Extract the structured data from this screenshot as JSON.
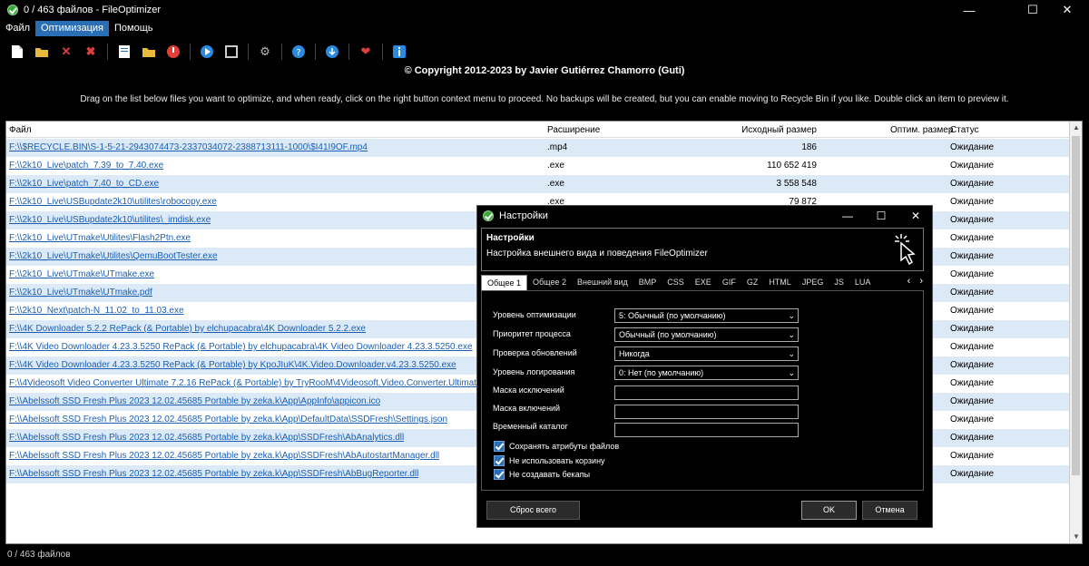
{
  "window": {
    "title": "0 / 463 файлов - FileOptimizer",
    "minimize": "—",
    "maximize": "☐",
    "close": "✕"
  },
  "menu": {
    "items": [
      {
        "label": "Файл"
      },
      {
        "label": "Оптимизация",
        "active": true
      },
      {
        "label": "Помощь"
      }
    ]
  },
  "toolbar": {
    "icons": [
      "add-files-icon",
      "add-folder-icon",
      "remove-icon",
      "clear-icon",
      "notes-icon",
      "folder-icon",
      "stop-icon",
      "play-icon",
      "pause-icon",
      "settings-icon",
      "help-icon",
      "update-icon",
      "heart-icon",
      "info-icon"
    ]
  },
  "copyright": "© Copyright 2012-2023 by Javier Gutiérrez Chamorro (Guti)",
  "instructions": "Drag on the list below files you want to optimize, and when ready, click on the right button context menu to proceed. No backups will be created, but you can enable moving to Recycle Bin if you like. Double click an item to preview it.",
  "list": {
    "headers": {
      "file": "Файл",
      "ext": "Расширение",
      "size": "Исходный размер",
      "opt": "Оптим. размер",
      "status": "Статус"
    },
    "rows": [
      {
        "file": "F:\\\\$RECYCLE.BIN\\S-1-5-21-2943074473-2337034072-2388713111-1000\\$I41I9OF.mp4",
        "ext": ".mp4",
        "size": "186",
        "status": "Ожидание"
      },
      {
        "file": "F:\\\\2k10_Live\\patch_7.39_to_7.40.exe",
        "ext": ".exe",
        "size": "110 652 419",
        "status": "Ожидание"
      },
      {
        "file": "F:\\\\2k10_Live\\patch_7.40_to_CD.exe",
        "ext": ".exe",
        "size": "3 558 548",
        "status": "Ожидание"
      },
      {
        "file": "F:\\\\2k10_Live\\USBupdate2k10\\utilites\\robocopy.exe",
        "ext": ".exe",
        "size": "79 872",
        "status": "Ожидание"
      },
      {
        "file": "F:\\\\2k10_Live\\USBupdate2k10\\utilites\\_imdisk.exe",
        "ext": "",
        "size": "",
        "status": "Ожидание"
      },
      {
        "file": "F:\\\\2k10_Live\\UTmake\\Utilites\\Flash2Ptn.exe",
        "ext": "",
        "size": "",
        "status": "Ожидание"
      },
      {
        "file": "F:\\\\2k10_Live\\UTmake\\Utilites\\QemuBootTester.exe",
        "ext": "",
        "size": "",
        "status": "Ожидание"
      },
      {
        "file": "F:\\\\2k10_Live\\UTmake\\UTmake.exe",
        "ext": "",
        "size": "",
        "status": "Ожидание"
      },
      {
        "file": "F:\\\\2k10_Live\\UTmake\\UTmake.pdf",
        "ext": "",
        "size": "",
        "status": "Ожидание"
      },
      {
        "file": "F:\\\\2k10_Next\\patch-N_11.02_to_11.03.exe",
        "ext": "",
        "size": "",
        "status": "Ожидание"
      },
      {
        "file": "F:\\\\4K Downloader 5.2.2 RePack (& Portable) by elchupacabra\\4K Downloader 5.2.2.exe",
        "ext": "",
        "size": "",
        "status": "Ожидание"
      },
      {
        "file": "F:\\\\4K Video Downloader 4.23.3.5250 RePack (& Portable) by elchupacabra\\4K Video Downloader 4.23.3.5250.exe",
        "ext": "",
        "size": "",
        "status": "Ожидание"
      },
      {
        "file": "F:\\\\4K Video Downloader 4.23.3.5250 RePack (& Portable) by KpoJIuK\\4K.Video.Downloader.v4.23.3.5250.exe",
        "ext": "",
        "size": "",
        "status": "Ожидание"
      },
      {
        "file": "F:\\\\4Videosoft Video Converter Ultimate 7.2.16 RePack (& Portable) by TryRooM\\4Videosoft.Video.Converter.Ultimate.7.2.16.exe",
        "ext": "",
        "size": "",
        "status": "Ожидание"
      },
      {
        "file": "F:\\\\Abelssoft SSD Fresh Plus 2023 12.02.45685 Portable by zeka.k\\App\\AppInfo\\appicon.ico",
        "ext": "",
        "size": "",
        "status": "Ожидание"
      },
      {
        "file": "F:\\\\Abelssoft SSD Fresh Plus 2023 12.02.45685 Portable by zeka.k\\App\\DefaultData\\SSDFresh\\Settings.json",
        "ext": "",
        "size": "",
        "status": "Ожидание"
      },
      {
        "file": "F:\\\\Abelssoft SSD Fresh Plus 2023 12.02.45685 Portable by zeka.k\\App\\SSDFresh\\AbAnalytics.dll",
        "ext": "",
        "size": "",
        "status": "Ожидание"
      },
      {
        "file": "F:\\\\Abelssoft SSD Fresh Plus 2023 12.02.45685 Portable by zeka.k\\App\\SSDFresh\\AbAutostartManager.dll",
        "ext": "",
        "size": "",
        "status": "Ожидание"
      },
      {
        "file": "F:\\\\Abelssoft SSD Fresh Plus 2023 12.02.45685 Portable by zeka.k\\App\\SSDFresh\\AbBugReporter.dll",
        "ext": "",
        "size": "",
        "status": "Ожидание"
      }
    ]
  },
  "statusbar": "0 / 463 файлов",
  "dialog": {
    "title": "Настройки",
    "header_title": "Настройки",
    "header_subtitle": "Настройка внешнего вида и поведения FileOptimizer",
    "tabs": [
      "Общее 1",
      "Общее 2",
      "Внешний вид",
      "BMP",
      "CSS",
      "EXE",
      "GIF",
      "GZ",
      "HTML",
      "JPEG",
      "JS",
      "LUA"
    ],
    "fields": {
      "opt_level_label": "Уровень оптимизации",
      "opt_level_value": "5: Обычный (по умолчанию)",
      "priority_label": "Приоритет процесса",
      "priority_value": "Обычный (по умолчанию)",
      "updates_label": "Проверка обновлений",
      "updates_value": "Никогда",
      "log_label": "Уровень логирования",
      "log_value": "0: Нет (по умолчанию)",
      "exclude_label": "Маска исключений",
      "include_label": "Маска включений",
      "temp_label": "Временный каталог"
    },
    "checkboxes": [
      {
        "label": "Сохранять атрибуты файлов",
        "checked": true
      },
      {
        "label": "Не использовать корзину",
        "checked": true
      },
      {
        "label": "Не создавать бекапы",
        "checked": true
      }
    ],
    "buttons": {
      "reset": "Сброс всего",
      "ok": "OK",
      "cancel": "Отмена"
    }
  },
  "colors": {
    "accent": "#2a6fb5",
    "row_alt": "#dce9f7",
    "link": "#1a5fb4"
  }
}
